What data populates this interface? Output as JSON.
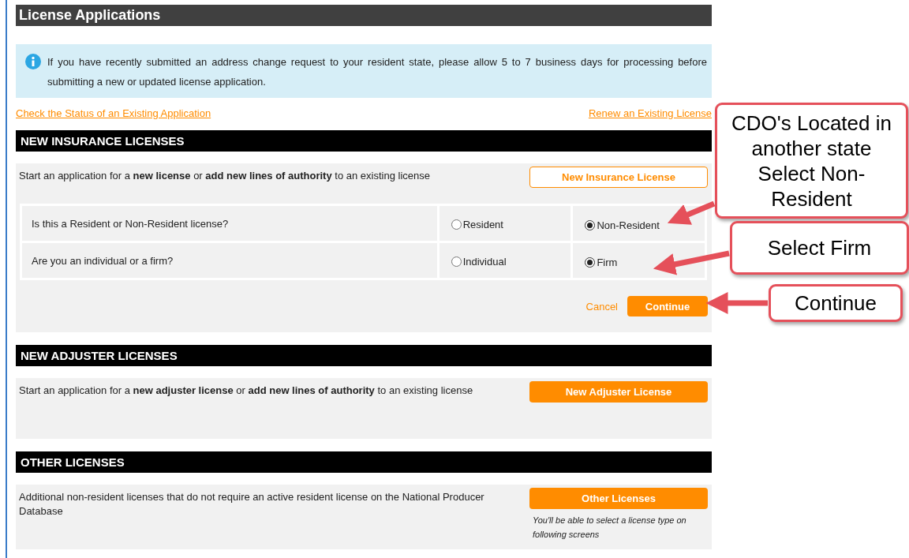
{
  "page_title": "License Applications",
  "notice": {
    "text": "If you have recently submitted an address change request to your resident state, please allow 5 to 7 business days for processing before submitting a new or updated license application."
  },
  "links": [
    {
      "label": "Check the Status of an Existing Application"
    },
    {
      "label": "Renew an Existing License"
    }
  ],
  "sections": [
    {
      "heading": "NEW INSURANCE LICENSES",
      "description": "Start an application for a **new license** or **add new lines of authority** to an existing license",
      "button": {
        "label": "New Insurance License",
        "kind": "outline"
      },
      "questions": [
        {
          "prompt": "Is this a Resident or Non-Resident license?",
          "options": [
            {
              "label": "Resident",
              "selected": false
            },
            {
              "label": "Non-Resident",
              "selected": true
            }
          ]
        },
        {
          "prompt": "Are you an individual or a firm?",
          "options": [
            {
              "label": "Individual",
              "selected": false
            },
            {
              "label": "Firm",
              "selected": true
            }
          ]
        }
      ],
      "actions": [
        {
          "label": "Cancel",
          "kind": "link"
        },
        {
          "label": "Continue",
          "kind": "primary"
        }
      ]
    },
    {
      "heading": "NEW ADJUSTER LICENSES",
      "description": "Start an application for a **new adjuster license** or **add new lines of authority** to an existing license",
      "button": {
        "label": "New Adjuster License",
        "kind": "filled"
      }
    },
    {
      "heading": "OTHER LICENSES",
      "description": "Additional non-resident licenses that do not require an active resident license on the National Producer Database",
      "button": {
        "label": "Other Licenses",
        "kind": "filled"
      },
      "note": "You'll be able to select a license type on following screens"
    }
  ],
  "callouts": [
    {
      "text": "CDO's Located in another state Select Non-Resident"
    },
    {
      "text": "Select Firm"
    },
    {
      "text": "Continue"
    }
  ]
}
